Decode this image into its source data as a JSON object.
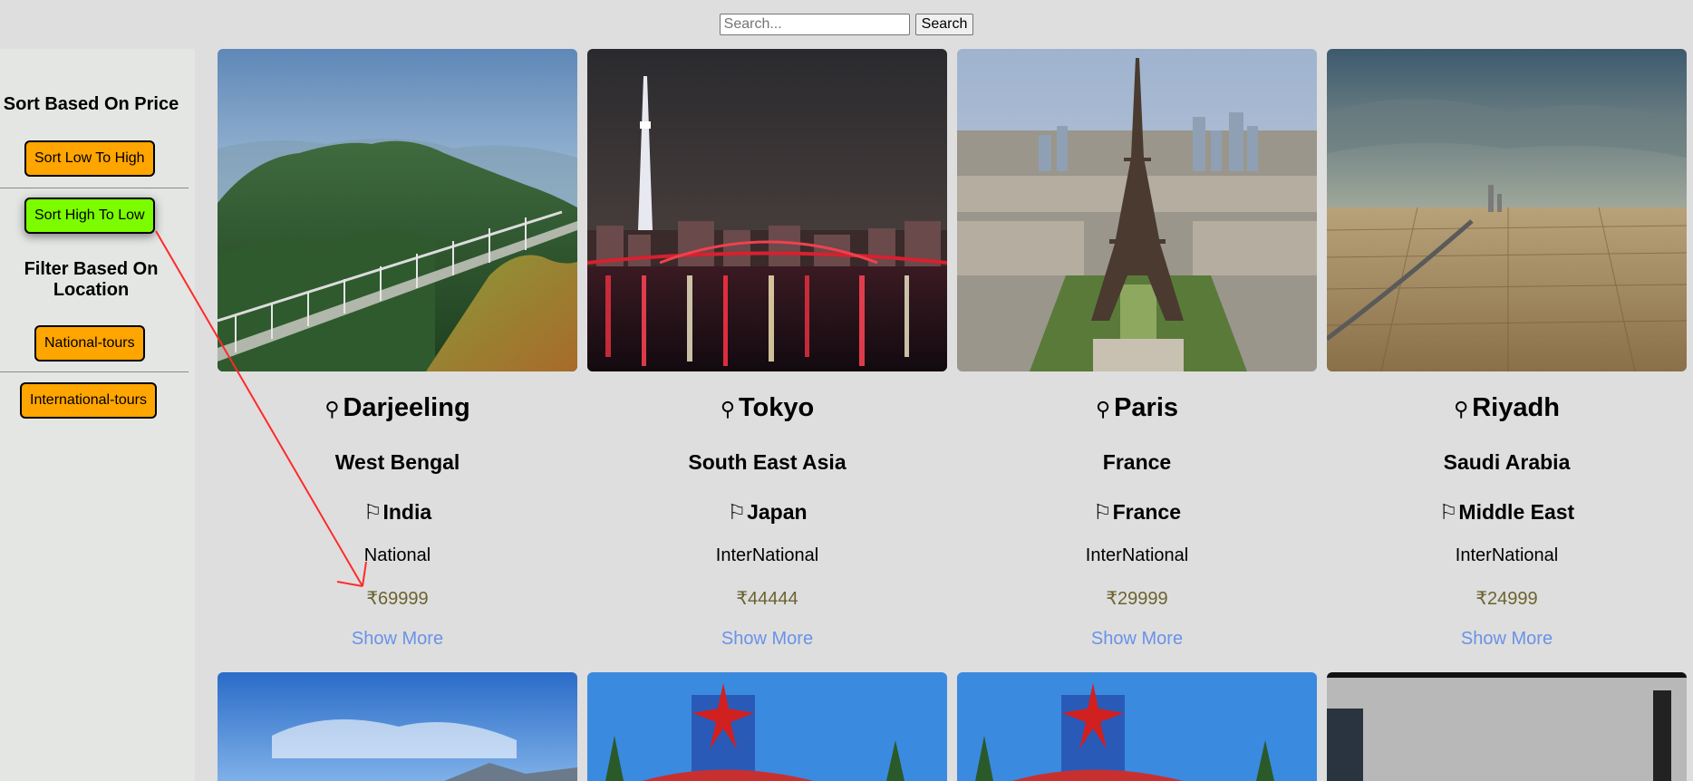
{
  "search": {
    "placeholder": "Search...",
    "value": "",
    "button_label": "Search"
  },
  "sidebar": {
    "sort_title": "Sort Based On Price",
    "sort_low_high": "Sort Low To High",
    "sort_high_low": "Sort High To Low",
    "filter_title": "Filter Based On Location",
    "national": "National-tours",
    "international": "International-tours"
  },
  "colors": {
    "page_bg": "#dedede",
    "sidebar_bg": "#e3e6e3",
    "button_orange": "#ffa500",
    "button_active_green": "#7cfc00",
    "price_color": "#6b6330",
    "link_color": "#6a92e8",
    "annotation_arrow": "#ff2a2a"
  },
  "icons": {
    "location": "location-pin-icon",
    "country": "flag-icon"
  },
  "tours": [
    {
      "city": "Darjeeling",
      "region": "West Bengal",
      "country": "India",
      "type": "National",
      "price": "₹69999",
      "more": "Show More",
      "image": "hill-ridge-photo"
    },
    {
      "city": "Tokyo",
      "region": "South East Asia",
      "country": "Japan",
      "type": "InterNational",
      "price": "₹44444",
      "more": "Show More",
      "image": "night-skyline-photo"
    },
    {
      "city": "Paris",
      "region": "France",
      "country": "France",
      "type": "InterNational",
      "price": "₹29999",
      "more": "Show More",
      "image": "eiffel-tower-photo"
    },
    {
      "city": "Riyadh",
      "region": "Saudi Arabia",
      "country": "Middle East",
      "type": "InterNational",
      "price": "₹24999",
      "more": "Show More",
      "image": "desert-city-photo"
    }
  ],
  "second_row": [
    "sky-photo",
    "welcome-sign-photo",
    "welcome-sign-photo",
    "skyline-photo"
  ]
}
